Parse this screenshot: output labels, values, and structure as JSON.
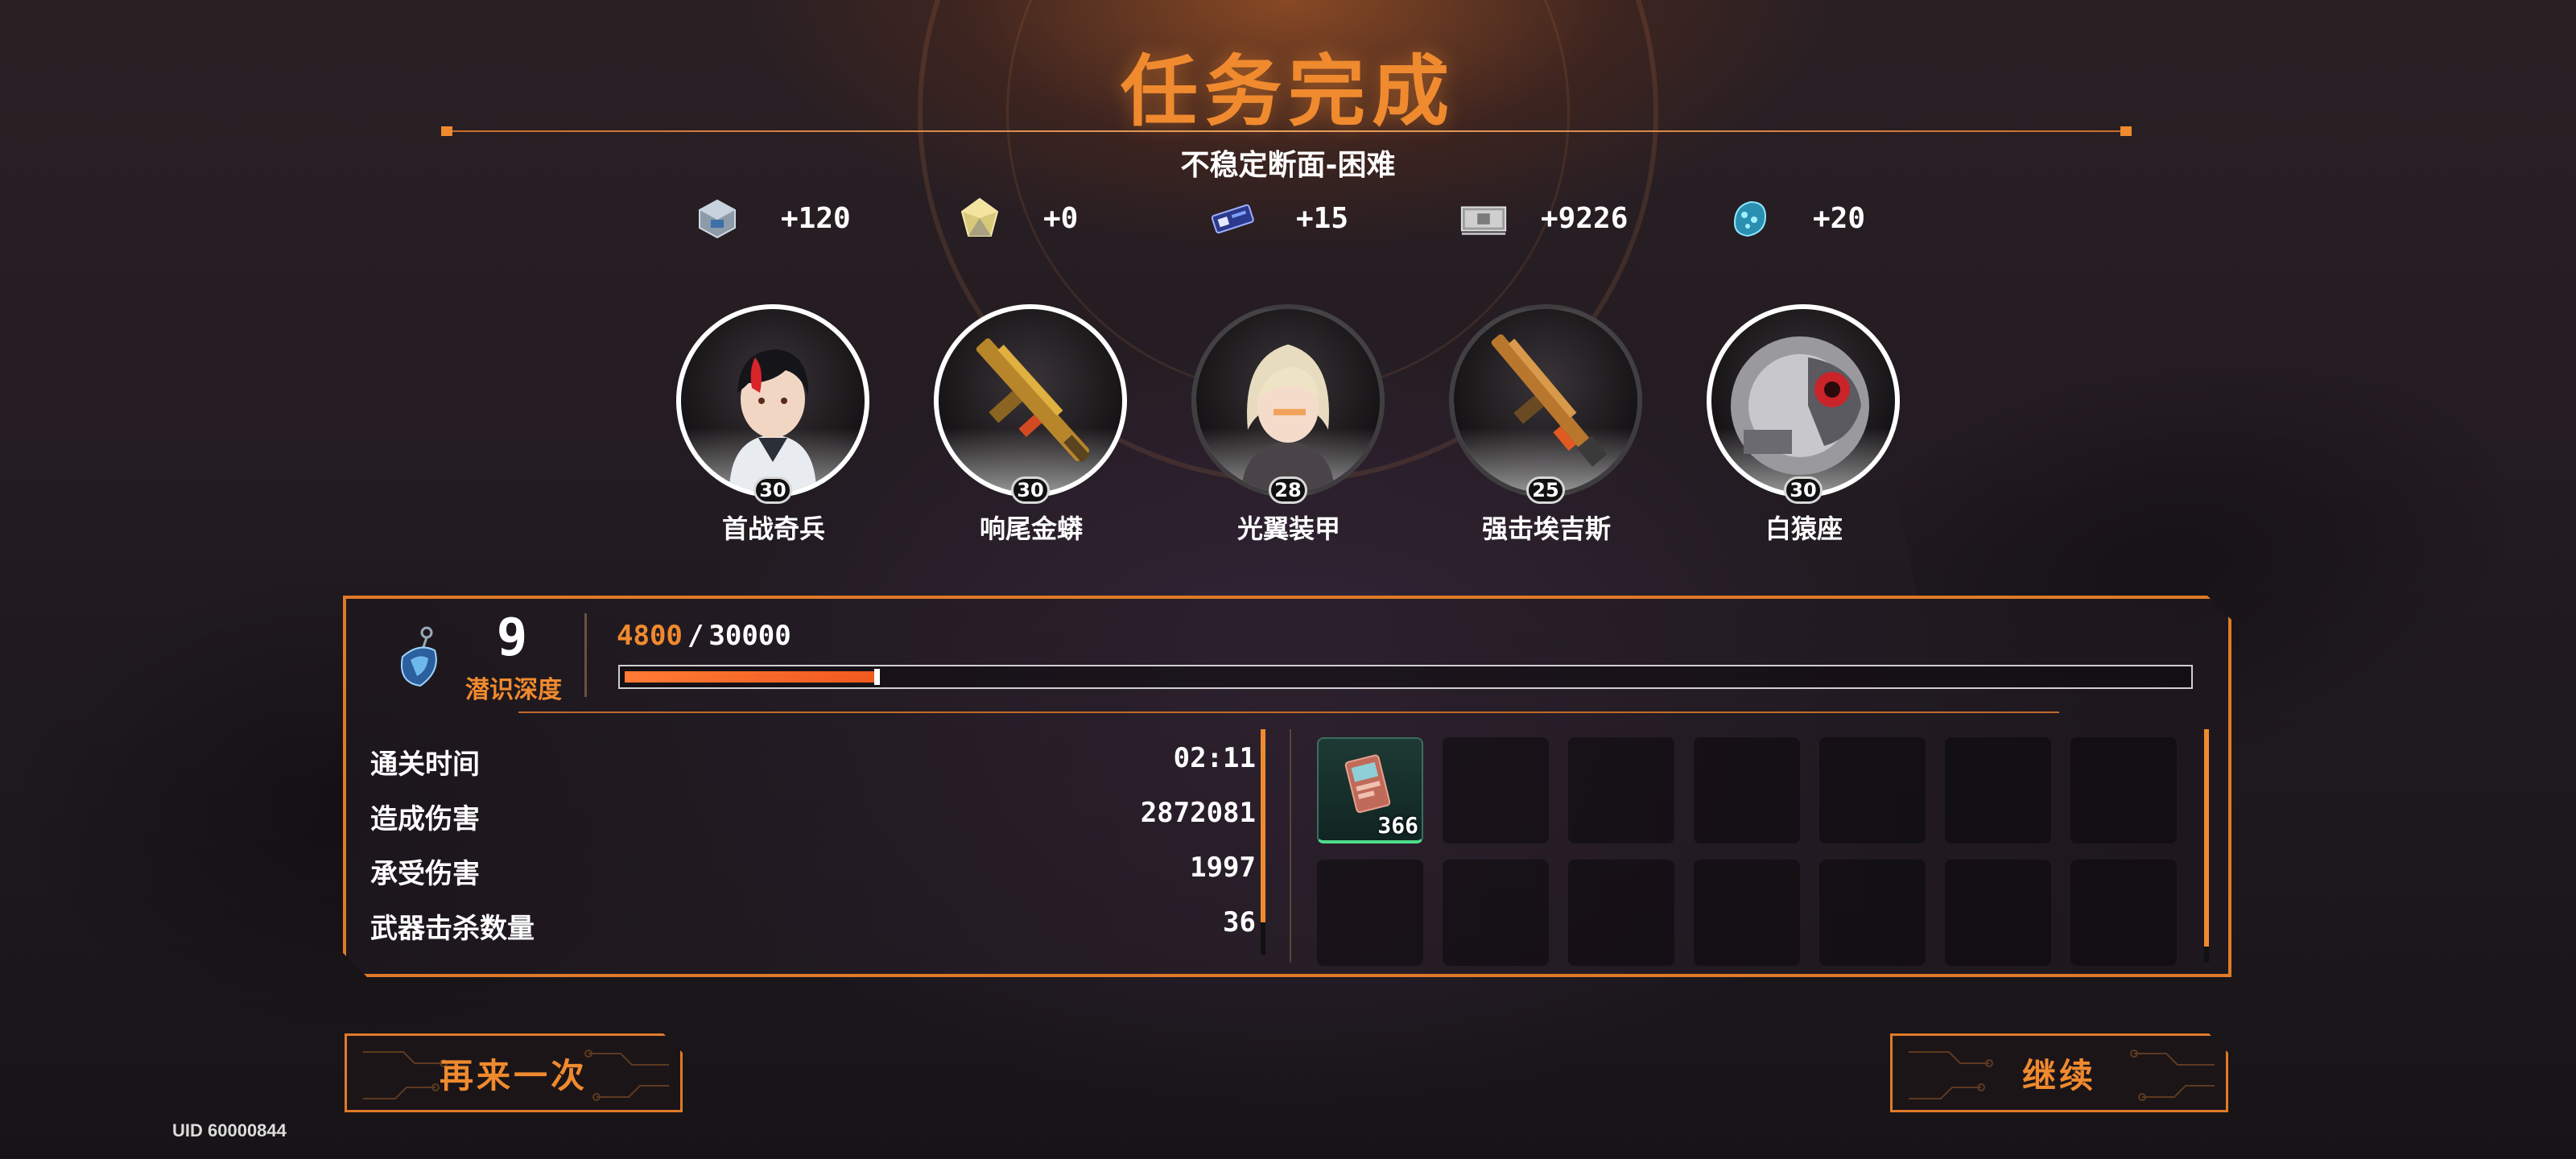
{
  "header": {
    "title": "任务完成",
    "subtitle": "不稳定断面-困难"
  },
  "rewards": [
    {
      "icon": "silver-cube-icon",
      "value": "+120"
    },
    {
      "icon": "gold-crystal-icon",
      "value": "+0"
    },
    {
      "icon": "blue-chip-icon",
      "value": "+15"
    },
    {
      "icon": "cash-stack-icon",
      "value": "+9226"
    },
    {
      "icon": "blue-gem-icon",
      "value": "+20"
    }
  ],
  "characters": [
    {
      "name": "首战奇兵",
      "level": "30"
    },
    {
      "name": "响尾金蟒",
      "level": "30"
    },
    {
      "name": "光翼装甲",
      "level": "28"
    },
    {
      "name": "强击埃吉斯",
      "level": "25"
    },
    {
      "name": "白猿座",
      "level": "30"
    }
  ],
  "depth": {
    "level": "9",
    "label": "潜识深度",
    "xp_current": "4800",
    "xp_separator": "/",
    "xp_max": "30000",
    "progress": 0.16
  },
  "stats": [
    {
      "label": "通关时间",
      "value": "02:11"
    },
    {
      "label": "造成伤害",
      "value": "2872081"
    },
    {
      "label": "承受伤害",
      "value": "1997"
    },
    {
      "label": "武器击杀数量",
      "value": "36"
    }
  ],
  "loot": {
    "items": [
      {
        "icon": "component-card-icon",
        "count": "366"
      }
    ],
    "slot_count": 14
  },
  "buttons": {
    "retry": "再来一次",
    "continue": "继续"
  },
  "footer": {
    "uid": "UID 60000844"
  },
  "colors": {
    "accent": "#f08a2e",
    "panel_border": "#e07a28",
    "xp_fill": "#f05a1e",
    "loot_rarity": "#4fdc8a"
  }
}
